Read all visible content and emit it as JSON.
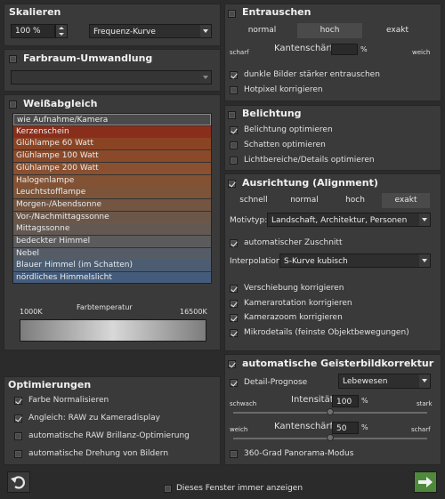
{
  "scale": {
    "title": "Skalieren",
    "percent": "100 %",
    "method": "Frequenz-Kurve"
  },
  "colorspace": {
    "title": "Farbraum-Umwandlung",
    "checked": false
  },
  "whitebalance": {
    "title": "Weißabgleich",
    "checked": false,
    "items": [
      {
        "label": "wie Aufnahme/Kamera",
        "color": "#4a4a4a"
      },
      {
        "label": "Kerzenschein",
        "color": "#8a2e1c"
      },
      {
        "label": "Glühlampe 60 Watt",
        "color": "#8a4424"
      },
      {
        "label": "Glühlampe 100 Watt",
        "color": "#8a4a2a"
      },
      {
        "label": "Glühlampe 200 Watt",
        "color": "#8a5030"
      },
      {
        "label": "Halogenlampe",
        "color": "#835234"
      },
      {
        "label": "Leuchtstofflampe",
        "color": "#7b543a"
      },
      {
        "label": "Morgen-/Abendsonne",
        "color": "#735542"
      },
      {
        "label": "Vor-/Nachmittagssonne",
        "color": "#6b574a"
      },
      {
        "label": "Mittagssonne",
        "color": "#645952"
      },
      {
        "label": "bedeckter Himmel",
        "color": "#5c5b5c"
      },
      {
        "label": "Nebel",
        "color": "#555c66"
      },
      {
        "label": "Blauer Himmel (im Schatten)",
        "color": "#4c5d72"
      },
      {
        "label": "nördliches Himmelslicht",
        "color": "#445c7c"
      }
    ],
    "temp_label": "Farbtemperatur",
    "temp_min": "1000K",
    "temp_max": "16500K"
  },
  "optim": {
    "title": "Optimierungen",
    "items": [
      {
        "label": "Farbe Normalisieren",
        "checked": true
      },
      {
        "label": "Angleich: RAW zu Kameradisplay",
        "checked": true
      },
      {
        "label": "automatische RAW Brillanz-Optimierung",
        "checked": false
      },
      {
        "label": "automatische Drehung von Bildern",
        "checked": false
      }
    ]
  },
  "denoise": {
    "title": "Entrauschen",
    "checked": false,
    "modes": [
      "normal",
      "hoch",
      "exakt"
    ],
    "selected": "hoch",
    "sharp_label": "Kantenschärfe",
    "sharp_value": "",
    "unit": "%",
    "left": "scharf",
    "right": "weich",
    "opt1": "dunkle Bilder stärker entrauschen",
    "opt1_checked": true,
    "opt2": "Hotpixel korrigieren",
    "opt2_checked": false
  },
  "exposure": {
    "title": "Belichtung",
    "checked": false,
    "items": [
      {
        "label": "Belichtung optimieren",
        "checked": true
      },
      {
        "label": "Schatten optimieren",
        "checked": false
      },
      {
        "label": "Lichtbereiche/Details optimieren",
        "checked": false
      }
    ]
  },
  "align": {
    "title": "Ausrichtung (Alignment)",
    "checked": true,
    "modes": [
      "schnell",
      "normal",
      "hoch",
      "exakt"
    ],
    "selected": "exakt",
    "motiv_label": "Motivtyp:",
    "motiv_value": "Landschaft, Architektur, Personen",
    "autocrop": "automatischer Zuschnitt",
    "autocrop_checked": true,
    "interp_label": "Interpolation:",
    "interp_value": "S-Kurve kubisch",
    "items": [
      {
        "label": "Verschiebung korrigieren",
        "checked": true
      },
      {
        "label": "Kamerarotation korrigieren",
        "checked": true
      },
      {
        "label": "Kamerazoom korrigieren",
        "checked": true
      },
      {
        "label": "Mikrodetails (feinste Objektbewegungen)",
        "checked": true
      }
    ]
  },
  "ghost": {
    "title": "automatische Geisterbildkorrektur",
    "checked": true,
    "detail_label": "Detail-Prognose",
    "detail_checked": true,
    "detail_value": "Lebewesen",
    "intensity_label": "Intensität",
    "intensity_value": "100",
    "intensity_left": "schwach",
    "intensity_right": "stark",
    "intensity_level": 1.0,
    "sharp_label": "Kantenschärfe",
    "sharp_value": "50",
    "sharp_left": "weich",
    "sharp_right": "scharf",
    "sharp_level": 0.5,
    "unit": "%",
    "panorama": "360-Grad Panorama-Modus",
    "panorama_checked": false
  },
  "footer": {
    "show_label": "Dieses Fenster immer anzeigen",
    "show_checked": false
  }
}
